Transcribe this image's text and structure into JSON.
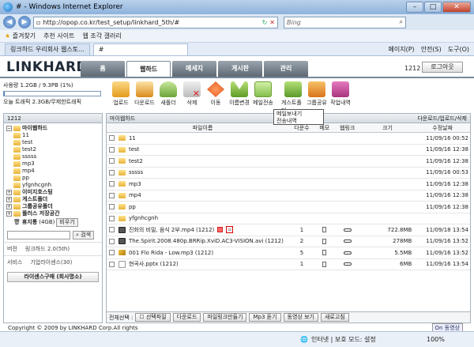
{
  "window": {
    "title": "# - Windows Internet Explorer"
  },
  "address": {
    "url": "http://opop.co.kr/test_setup/linkhard_5th/#",
    "search": "Bing"
  },
  "favorites": {
    "fav": "즐겨찾기",
    "suggest": "추천 사이트",
    "gallery": "웹 조각 갤러리"
  },
  "tabs": [
    {
      "label": "링크하드 우리회사 웹스토..."
    },
    {
      "label": "#"
    }
  ],
  "commands": [
    "페이지(P)",
    "안전(S)",
    "도구(O)"
  ],
  "site": {
    "logo": "LINKHARD",
    "nav": [
      "홈",
      "웹하드",
      "메세지",
      "게시판",
      "관리"
    ],
    "active_nav": "웹하드",
    "user_num": "1212",
    "logout": "로그아웃"
  },
  "usage": {
    "used": "사용량 1.2GB / 9.3PB (1%)",
    "fraction": 0.01,
    "traffic": "오늘 트래픽 2.3GB/무제한트래픽"
  },
  "toolbar": [
    {
      "label": "업로드",
      "icon": "upload-icon",
      "cls": "up"
    },
    {
      "label": "다운로드",
      "icon": "download-icon",
      "cls": "down"
    },
    {
      "label": "새폴더",
      "icon": "new-folder-icon",
      "cls": "folder"
    },
    {
      "label": "삭제",
      "icon": "delete-icon",
      "cls": "del"
    },
    {
      "label": "이동",
      "icon": "move-icon",
      "cls": "move"
    },
    {
      "label": "이름변경",
      "icon": "rename-icon",
      "cls": "rename"
    },
    {
      "label": "메일전송",
      "icon": "mail-icon",
      "cls": "mail"
    },
    {
      "label": "게스트폴더",
      "icon": "guest-folder-icon",
      "cls": "guest"
    },
    {
      "label": "그룹공유",
      "icon": "group-share-icon",
      "cls": "group"
    },
    {
      "label": "작업내역",
      "icon": "history-icon",
      "cls": "log"
    }
  ],
  "tooltip": {
    "line1": "메일보내기",
    "line2": "전송내역"
  },
  "sidebar": {
    "header": "1212",
    "root": "마이웹하드",
    "folders": [
      "11",
      "test",
      "test2",
      "sssss",
      "mp3",
      "mp4",
      "pp",
      "yfgnhcgnh"
    ],
    "sections": [
      "이미지호스팅",
      "게스트폴더",
      "그룹공유폴더",
      "플러스 저장공간",
      "휴지통"
    ],
    "trash_size": "(4GB)",
    "trash_btn": "비우기",
    "search_btn": "검색",
    "version_label": "버전",
    "version_value": "링크하드 2.0(5th)",
    "service_label": "서비스",
    "service_value": "기업라이센스(30)",
    "license": "라이센스구매 (회사명소)"
  },
  "main": {
    "path": "마이웹하드",
    "actions": "다운로드/업로드/삭제",
    "columns": {
      "name": "파일이름",
      "dl": "다운수",
      "memo": "메모",
      "link": "웹링크",
      "size": "크기",
      "date": "수정날짜"
    },
    "rows": [
      {
        "type": "dir",
        "name": "11",
        "dl": "",
        "size": "",
        "date": "11/09/16 00:52"
      },
      {
        "type": "dir",
        "name": "test",
        "dl": "",
        "size": "",
        "date": "11/09/16 12:38"
      },
      {
        "type": "dir",
        "name": "test2",
        "dl": "",
        "size": "",
        "date": "11/09/16 12:38"
      },
      {
        "type": "dir",
        "name": "sssss",
        "dl": "",
        "size": "",
        "date": "11/09/16 00:53"
      },
      {
        "type": "dir",
        "name": "mp3",
        "dl": "",
        "size": "",
        "date": "11/09/16 12:38"
      },
      {
        "type": "dir",
        "name": "mp4",
        "dl": "",
        "size": "",
        "date": "11/09/16 12:38"
      },
      {
        "type": "dir",
        "name": "pp",
        "dl": "",
        "size": "",
        "date": "11/09/16 12:38"
      },
      {
        "type": "dir",
        "name": "yfgnhcgnh",
        "dl": "",
        "size": "",
        "date": ""
      },
      {
        "type": "mov",
        "name": "진화의 비밀, 음식 2부.mp4 (1212)",
        "dl": "1",
        "size": "722.8MB",
        "date": "11/09/18 13:54"
      },
      {
        "type": "mov",
        "name": "The.Spirit.2008.480p.BRRip.XviD.AC3-VISION.avi (1212)",
        "dl": "2",
        "size": "278MB",
        "date": "11/09/16 13:52"
      },
      {
        "type": "mp3",
        "name": "001 Flo Rida - Low.mp3 (1212)",
        "dl": "5",
        "size": "5.5MB",
        "date": "11/09/16 13:52"
      },
      {
        "type": "ppt",
        "name": "현곡사.pptx (1212)",
        "dl": "1",
        "size": "6MB",
        "date": "11/09/16 13:54"
      }
    ],
    "bottom": {
      "select_all": "전체선택 :",
      "select_file": "선택파일",
      "buttons": [
        "다운로드",
        "파일링크만들기",
        "Mp3 듣기",
        "동영상 보기",
        "새로고침"
      ]
    }
  },
  "footer": {
    "copyright": "Copyright © 2009 by LINKHARD Corp.All rights",
    "on_btn": "On 동영상"
  },
  "statusbar": {
    "zone": "인터넷 | 보호 모드: 설정",
    "zoom": "100%"
  }
}
